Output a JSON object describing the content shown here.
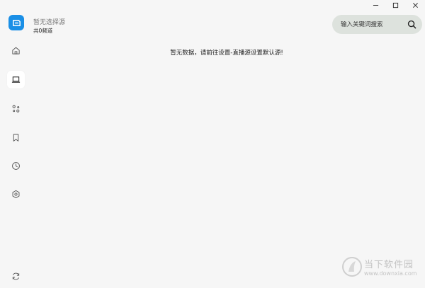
{
  "header": {
    "source_title": "暂无选择源",
    "channel_count": "共0频道"
  },
  "search": {
    "placeholder": "输入关键词搜索"
  },
  "sidebar": {
    "items": [
      {
        "name": "home",
        "icon": "home-icon",
        "active": false
      },
      {
        "name": "live",
        "icon": "laptop-icon",
        "active": true
      },
      {
        "name": "sources",
        "icon": "nodes-icon",
        "active": false
      },
      {
        "name": "favorites",
        "icon": "bookmark-icon",
        "active": false
      },
      {
        "name": "history",
        "icon": "clock-icon",
        "active": false
      },
      {
        "name": "settings",
        "icon": "gear-icon",
        "active": false
      },
      {
        "name": "refresh",
        "icon": "refresh-icon",
        "active": false
      }
    ]
  },
  "main": {
    "empty_message": "暂无数据，请前往设置-直播源设置默认源!"
  },
  "watermark": {
    "brand_cn": "当下软件园",
    "brand_en": "www.downxia.com"
  },
  "colors": {
    "background": "#f6f6f6",
    "accent": "#1a8fe6",
    "search_bg": "#dde2dd"
  }
}
